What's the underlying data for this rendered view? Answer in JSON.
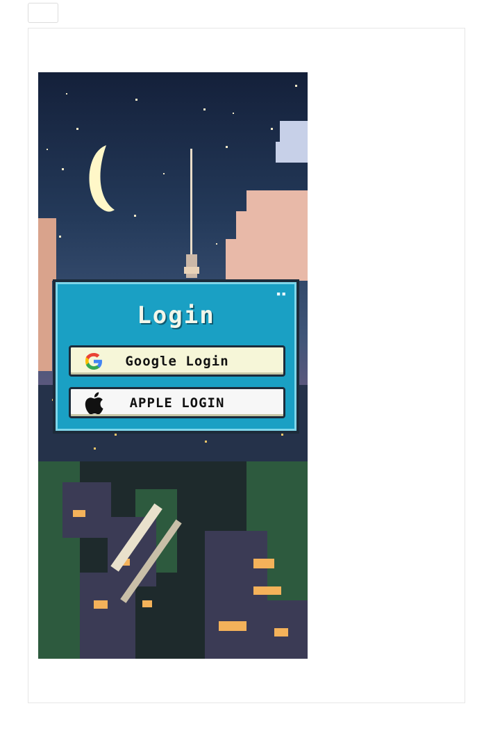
{
  "toolbar": {
    "button_label": ""
  },
  "login": {
    "title": "Login",
    "dots": "▪▪",
    "google_label": "Google Login",
    "apple_label": "APPLE LOGIN"
  },
  "colors": {
    "panel": "#1aa0c4",
    "google_button": "#f6f6d8",
    "apple_button": "#f7f7f7",
    "sky_top": "#1b2740",
    "sky_bottom": "#a04a3a"
  },
  "icons": {
    "google": "google-g-icon",
    "apple": "apple-logo-icon"
  }
}
